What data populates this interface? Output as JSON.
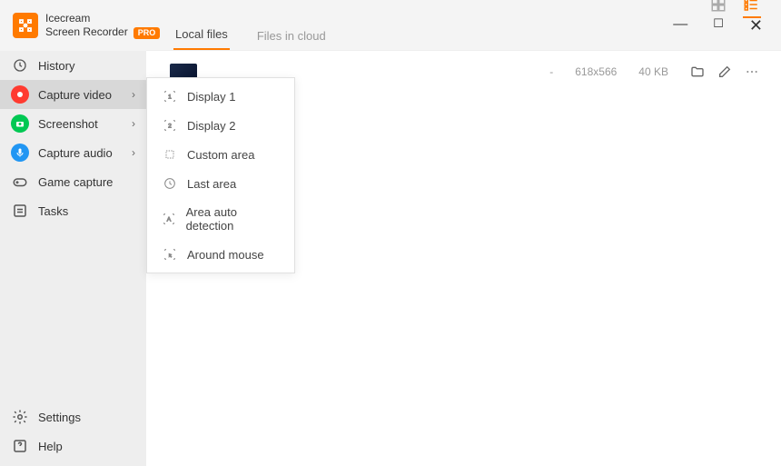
{
  "app": {
    "line1": "Icecream",
    "line2": "Screen Recorder",
    "badge": "PRO"
  },
  "sidebar": {
    "items": [
      {
        "label": "History"
      },
      {
        "label": "Capture video"
      },
      {
        "label": "Screenshot"
      },
      {
        "label": "Capture audio"
      },
      {
        "label": "Game capture"
      },
      {
        "label": "Tasks"
      }
    ],
    "footer": [
      {
        "label": "Settings"
      },
      {
        "label": "Help"
      }
    ]
  },
  "tabs": {
    "local": "Local files",
    "cloud": "Files in cloud"
  },
  "row": {
    "dash": "-",
    "dims": "618x566",
    "size": "40 KB"
  },
  "submenu": {
    "items": [
      {
        "label": "Display 1"
      },
      {
        "label": "Display 2"
      },
      {
        "label": "Custom area"
      },
      {
        "label": "Last area"
      },
      {
        "label": "Area auto detection"
      },
      {
        "label": "Around mouse"
      }
    ]
  }
}
